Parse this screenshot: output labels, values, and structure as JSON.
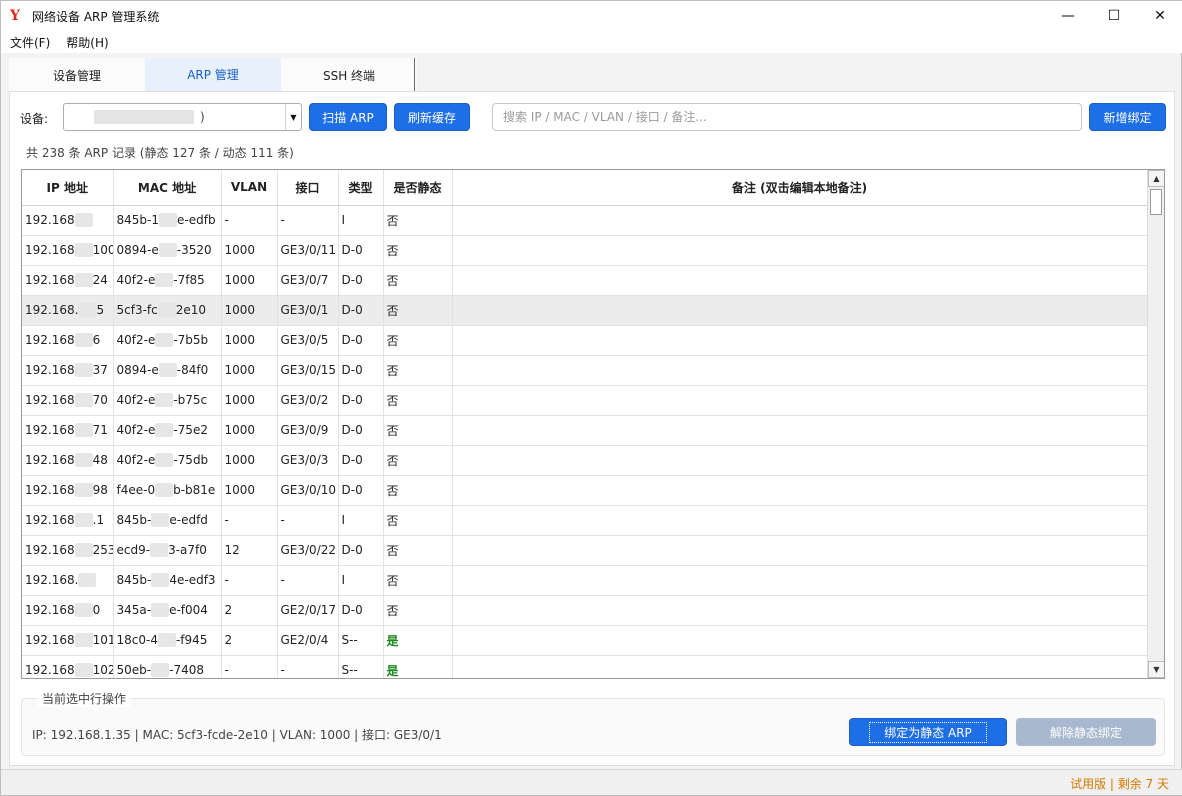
{
  "window": {
    "title": "网络设备 ARP 管理系统",
    "logo": "Y"
  },
  "controls": {
    "minimize": "—",
    "maximize": "☐",
    "close": "✕"
  },
  "menu": [
    {
      "label": "文件(F)"
    },
    {
      "label": "帮助(H)"
    }
  ],
  "tabs": [
    {
      "label": "设备管理",
      "active": false
    },
    {
      "label": "ARP 管理",
      "active": true
    },
    {
      "label": "SSH 终端",
      "active": false
    }
  ],
  "toolbar": {
    "device_label": "设备:",
    "device_value_tail": ")",
    "scan_label": "扫描 ARP",
    "refresh_label": "刷新缓存",
    "search_placeholder": "搜索 IP / MAC / VLAN / 接口 / 备注...",
    "add_label": "新增绑定"
  },
  "summary": "共 238 条 ARP 记录 (静态 127 条 / 动态 111 条)",
  "table": {
    "columns": [
      "IP 地址",
      "MAC 地址",
      "VLAN",
      "接口",
      "类型",
      "是否静态",
      "备注 (双击编辑本地备注)"
    ],
    "rows": [
      {
        "ip_a": "192.168",
        "ip_b": "",
        "mac_a": "845b-1",
        "mac_b": "e-edfb",
        "vlan": "-",
        "iface": "-",
        "type": "I",
        "static": "否",
        "note": ""
      },
      {
        "ip_a": "192.168",
        "ip_b": "100",
        "mac_a": "0894-e",
        "mac_b": "-3520",
        "vlan": "1000",
        "iface": "GE3/0/11",
        "type": "D-0",
        "static": "否",
        "note": ""
      },
      {
        "ip_a": "192.168",
        "ip_b": "24",
        "mac_a": "40f2-e",
        "mac_b": "-7f85",
        "vlan": "1000",
        "iface": "GE3/0/7",
        "type": "D-0",
        "static": "否",
        "note": ""
      },
      {
        "ip_a": "192.168.",
        "ip_b": "5",
        "mac_a": "5cf3-fc",
        "mac_b": "2e10",
        "vlan": "1000",
        "iface": "GE3/0/1",
        "type": "D-0",
        "static": "否",
        "note": "",
        "selected": true
      },
      {
        "ip_a": "192.168",
        "ip_b": "6",
        "mac_a": "40f2-e",
        "mac_b": "-7b5b",
        "vlan": "1000",
        "iface": "GE3/0/5",
        "type": "D-0",
        "static": "否",
        "note": ""
      },
      {
        "ip_a": "192.168",
        "ip_b": "37",
        "mac_a": "0894-e",
        "mac_b": "-84f0",
        "vlan": "1000",
        "iface": "GE3/0/15",
        "type": "D-0",
        "static": "否",
        "note": ""
      },
      {
        "ip_a": "192.168",
        "ip_b": "70",
        "mac_a": "40f2-e",
        "mac_b": "-b75c",
        "vlan": "1000",
        "iface": "GE3/0/2",
        "type": "D-0",
        "static": "否",
        "note": ""
      },
      {
        "ip_a": "192.168",
        "ip_b": "71",
        "mac_a": "40f2-e",
        "mac_b": "-75e2",
        "vlan": "1000",
        "iface": "GE3/0/9",
        "type": "D-0",
        "static": "否",
        "note": ""
      },
      {
        "ip_a": "192.168",
        "ip_b": "48",
        "mac_a": "40f2-e",
        "mac_b": "-75db",
        "vlan": "1000",
        "iface": "GE3/0/3",
        "type": "D-0",
        "static": "否",
        "note": ""
      },
      {
        "ip_a": "192.168",
        "ip_b": "98",
        "mac_a": "f4ee-0",
        "mac_b": "b-b81e",
        "vlan": "1000",
        "iface": "GE3/0/10",
        "type": "D-0",
        "static": "否",
        "note": ""
      },
      {
        "ip_a": "192.168",
        "ip_b": ".1",
        "mac_a": "845b-",
        "mac_b": "e-edfd",
        "vlan": "-",
        "iface": "-",
        "type": "I",
        "static": "否",
        "note": ""
      },
      {
        "ip_a": "192.168",
        "ip_b": "253",
        "mac_a": "ecd9-",
        "mac_b": "3-a7f0",
        "vlan": "12",
        "iface": "GE3/0/22",
        "type": "D-0",
        "static": "否",
        "note": ""
      },
      {
        "ip_a": "192.168.",
        "ip_b": "",
        "mac_a": "845b-",
        "mac_b": "4e-edf3",
        "vlan": "-",
        "iface": "-",
        "type": "I",
        "static": "否",
        "note": ""
      },
      {
        "ip_a": "192.168",
        "ip_b": "0",
        "mac_a": "345a-",
        "mac_b": "e-f004",
        "vlan": "2",
        "iface": "GE2/0/17",
        "type": "D-0",
        "static": "否",
        "note": ""
      },
      {
        "ip_a": "192.168",
        "ip_b": "101",
        "mac_a": "18c0-4",
        "mac_b": "-f945",
        "vlan": "2",
        "iface": "GE2/0/4",
        "type": "S--",
        "static": "是",
        "note": ""
      },
      {
        "ip_a": "192.168",
        "ip_b": "102",
        "mac_a": "50eb-",
        "mac_b": "-7408",
        "vlan": "-",
        "iface": "-",
        "type": "S--",
        "static": "是",
        "note": ""
      }
    ]
  },
  "selection": {
    "group_title": "当前选中行操作",
    "info": "IP: 192.168.1.35 | MAC: 5cf3-fcde-2e10 | VLAN: 1000 | 接口: GE3/0/1",
    "bind_label": "绑定为静态 ARP",
    "unbind_label": "解除静态绑定"
  },
  "status": "试用版 | 剩余 7 天",
  "colors": {
    "accent": "#1e6ee6",
    "static_yes": "#1f8a1f",
    "trial": "#d27a00",
    "disabled": "#a8b8cf"
  }
}
